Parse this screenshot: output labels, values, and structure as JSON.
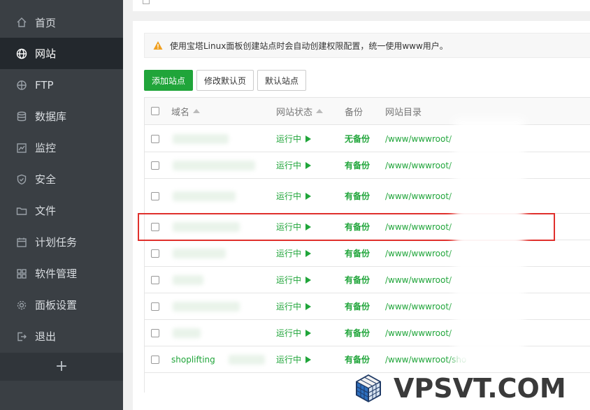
{
  "sidebar": {
    "items": [
      {
        "label": "首页",
        "icon": "home-icon"
      },
      {
        "label": "网站",
        "icon": "globe-icon"
      },
      {
        "label": "FTP",
        "icon": "ftp-icon"
      },
      {
        "label": "数据库",
        "icon": "database-icon"
      },
      {
        "label": "监控",
        "icon": "monitor-icon"
      },
      {
        "label": "安全",
        "icon": "shield-icon"
      },
      {
        "label": "文件",
        "icon": "folder-icon"
      },
      {
        "label": "计划任务",
        "icon": "calendar-icon"
      },
      {
        "label": "软件管理",
        "icon": "apps-icon"
      },
      {
        "label": "面板设置",
        "icon": "gear-icon"
      },
      {
        "label": "退出",
        "icon": "logout-icon"
      }
    ],
    "add_label": "+"
  },
  "notice": {
    "text": "使用宝塔Linux面板创建站点时会自动创建权限配置，统一使用www用户。"
  },
  "toolbar": {
    "add_site": "添加站点",
    "edit_default_page": "修改默认页",
    "default_site": "默认站点"
  },
  "table": {
    "headers": {
      "domain": "域名",
      "status": "网站状态",
      "backup": "备份",
      "dir": "网站目录"
    },
    "rows": [
      {
        "domain": "",
        "status": "运行中",
        "backup": "无备份",
        "dir": "/www/wwwroot/"
      },
      {
        "domain": "",
        "status": "运行中",
        "backup": "有备份",
        "dir": "/www/wwwroot/"
      },
      {
        "domain": "",
        "status": "运行中",
        "backup": "有备份",
        "dir": "/www/wwwroot/"
      },
      {
        "domain": "",
        "status": "运行中",
        "backup": "有备份",
        "dir": "/www/wwwroot/"
      },
      {
        "domain": "",
        "status": "运行中",
        "backup": "有备份",
        "dir": "/www/wwwroot/"
      },
      {
        "domain": "",
        "status": "运行中",
        "backup": "有备份",
        "dir": "/www/wwwroot/"
      },
      {
        "domain": "",
        "status": "运行中",
        "backup": "有备份",
        "dir": "/www/wwwroot/"
      },
      {
        "domain": "",
        "status": "运行中",
        "backup": "有备份",
        "dir": "/www/wwwroot/"
      },
      {
        "domain": "shoplifting",
        "status": "运行中",
        "backup": "有备份",
        "dir": "/www/wwwroot/sho"
      }
    ]
  },
  "watermark": {
    "text": "VPSVT.COM"
  },
  "colors": {
    "sidebar": "#3a3f44",
    "sidebar_active": "#23282d",
    "accent": "#20a53a",
    "highlight": "#e0302c"
  }
}
